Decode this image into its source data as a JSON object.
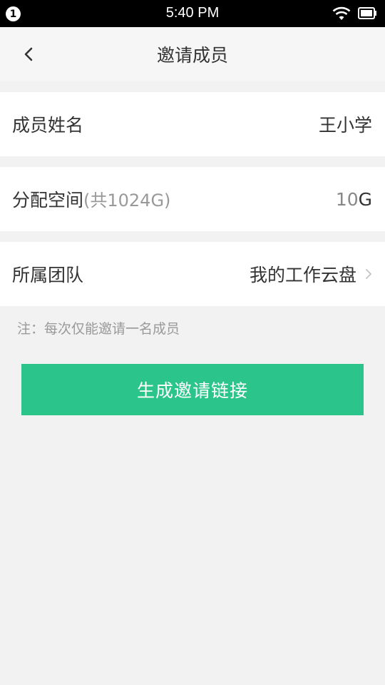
{
  "status_bar": {
    "notification_count": "1",
    "time": "5:40 PM"
  },
  "header": {
    "title": "邀请成员",
    "back_icon": "chevron-left-icon"
  },
  "form": {
    "member_name": {
      "label": "成员姓名",
      "value": "王小学"
    },
    "space": {
      "label": "分配空间",
      "hint": "(共1024G)",
      "value_number": "10",
      "value_unit": "G"
    },
    "team": {
      "label": "所属团队",
      "value": "我的工作云盘",
      "icon": "chevron-right-icon"
    }
  },
  "note": "注：每次仅能邀请一名成员",
  "primary_button": {
    "label": "生成邀请链接"
  },
  "colors": {
    "accent": "#2bc48a",
    "background": "#f2f2f2",
    "text": "#333333",
    "muted": "#999999"
  }
}
